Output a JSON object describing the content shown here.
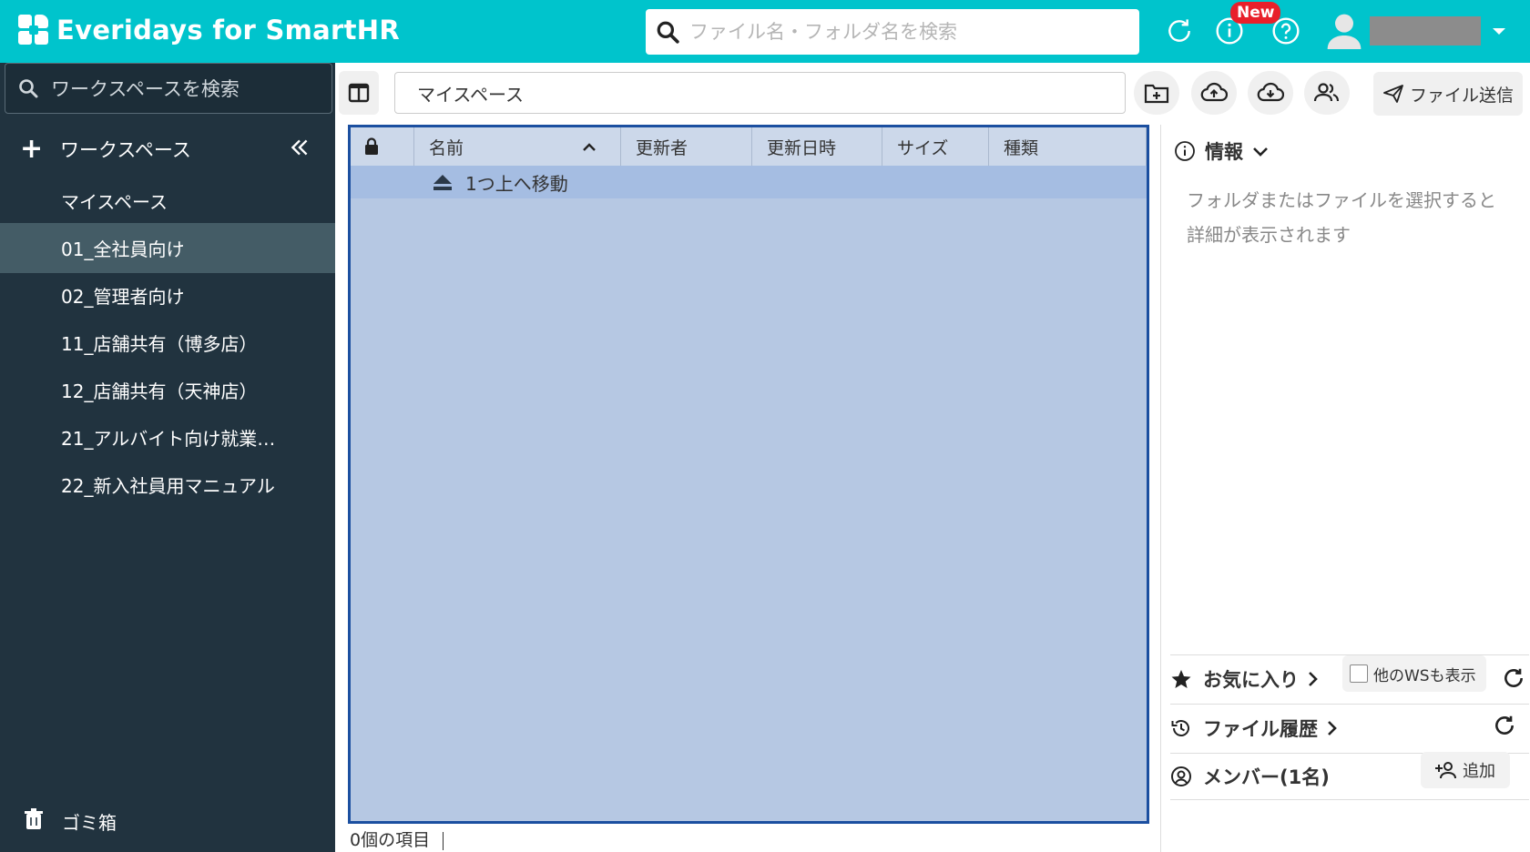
{
  "app": {
    "title": "Everidays for SmartHR"
  },
  "header": {
    "search_placeholder": "ファイル名・フォルダ名を検索",
    "new_badge": "New"
  },
  "sidebar": {
    "search_placeholder": "ワークスペースを検索",
    "workspace_label": "ワークスペース",
    "items": [
      {
        "label": "マイスペース",
        "active": false
      },
      {
        "label": "01_全社員向け",
        "active": true
      },
      {
        "label": "02_管理者向け",
        "active": false
      },
      {
        "label": "11_店舗共有（博多店）",
        "active": false
      },
      {
        "label": "12_店舗共有（天神店）",
        "active": false
      },
      {
        "label": "21_アルバイト向け就業…",
        "active": false
      },
      {
        "label": "22_新入社員用マニュアル",
        "active": false
      }
    ],
    "trash_label": "ゴミ箱"
  },
  "toolbar": {
    "path": "マイスペース",
    "send_label": "ファイル送信"
  },
  "file_list": {
    "columns": [
      "名前",
      "更新者",
      "更新日時",
      "サイズ",
      "種類"
    ],
    "up_row": "1つ上へ移動",
    "status": "0個の項目"
  },
  "right_panel": {
    "info_title": "情報",
    "info_message_line1": "フォルダまたはファイルを選択すると",
    "info_message_line2": "詳細が表示されます",
    "favorites_label": "お気に入り",
    "show_other_ws": "他のWSも表示",
    "history_label": "ファイル履歴",
    "members_label": "メンバー(1名)",
    "add_label": "追加"
  },
  "colors": {
    "brand": "#00c4cc",
    "sidebar_bg": "#21333f",
    "sidebar_active": "#445c66",
    "panel_bg": "#b6c8e3",
    "panel_border": "#1b4fa0",
    "badge": "#e8202a"
  }
}
